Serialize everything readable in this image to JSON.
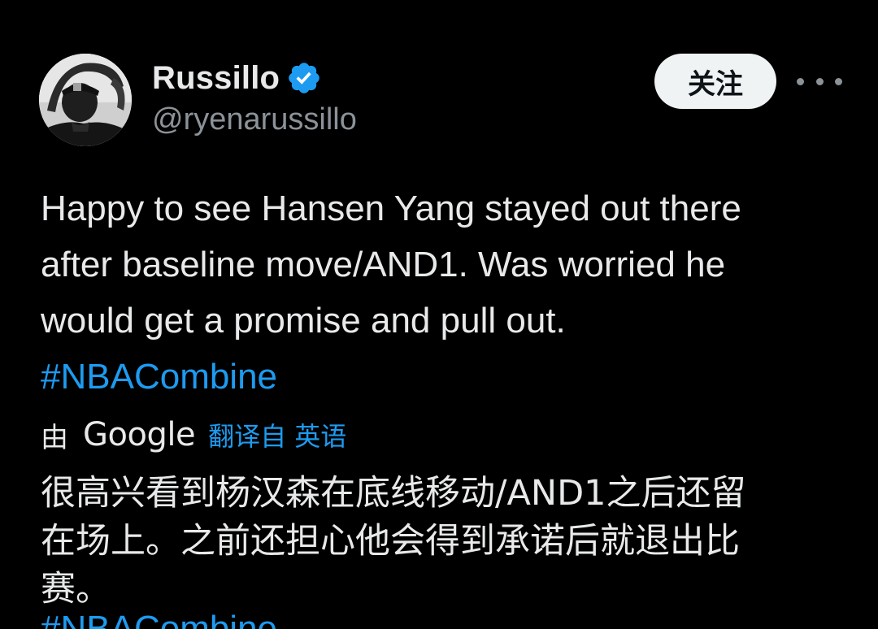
{
  "author": {
    "display_name": "Russillo",
    "handle": "@ryenarussillo",
    "verified": true,
    "verified_color": "#1d9bf0"
  },
  "actions": {
    "follow_label": "关注",
    "more_icon": "more-horizontal-icon"
  },
  "tweet": {
    "lines": [
      "Happy to see Hansen Yang stayed out there",
      "after baseline move/AND1. Was worried he",
      "would get a promise and pull out."
    ],
    "hashtag": "#NBACombine"
  },
  "translation": {
    "by_label": "由",
    "provider": "Google",
    "link_label": "翻译自 英语",
    "lines": [
      "很高兴看到杨汉森在底线移动/AND1之后还留",
      "在场上。之前还担心他会得到承诺后就退出比",
      "赛。"
    ],
    "hashtag": "#NBACombine"
  },
  "colors": {
    "background": "#000000",
    "text": "#e7e9ea",
    "secondary": "#8b9298",
    "link": "#1d9bf0"
  }
}
